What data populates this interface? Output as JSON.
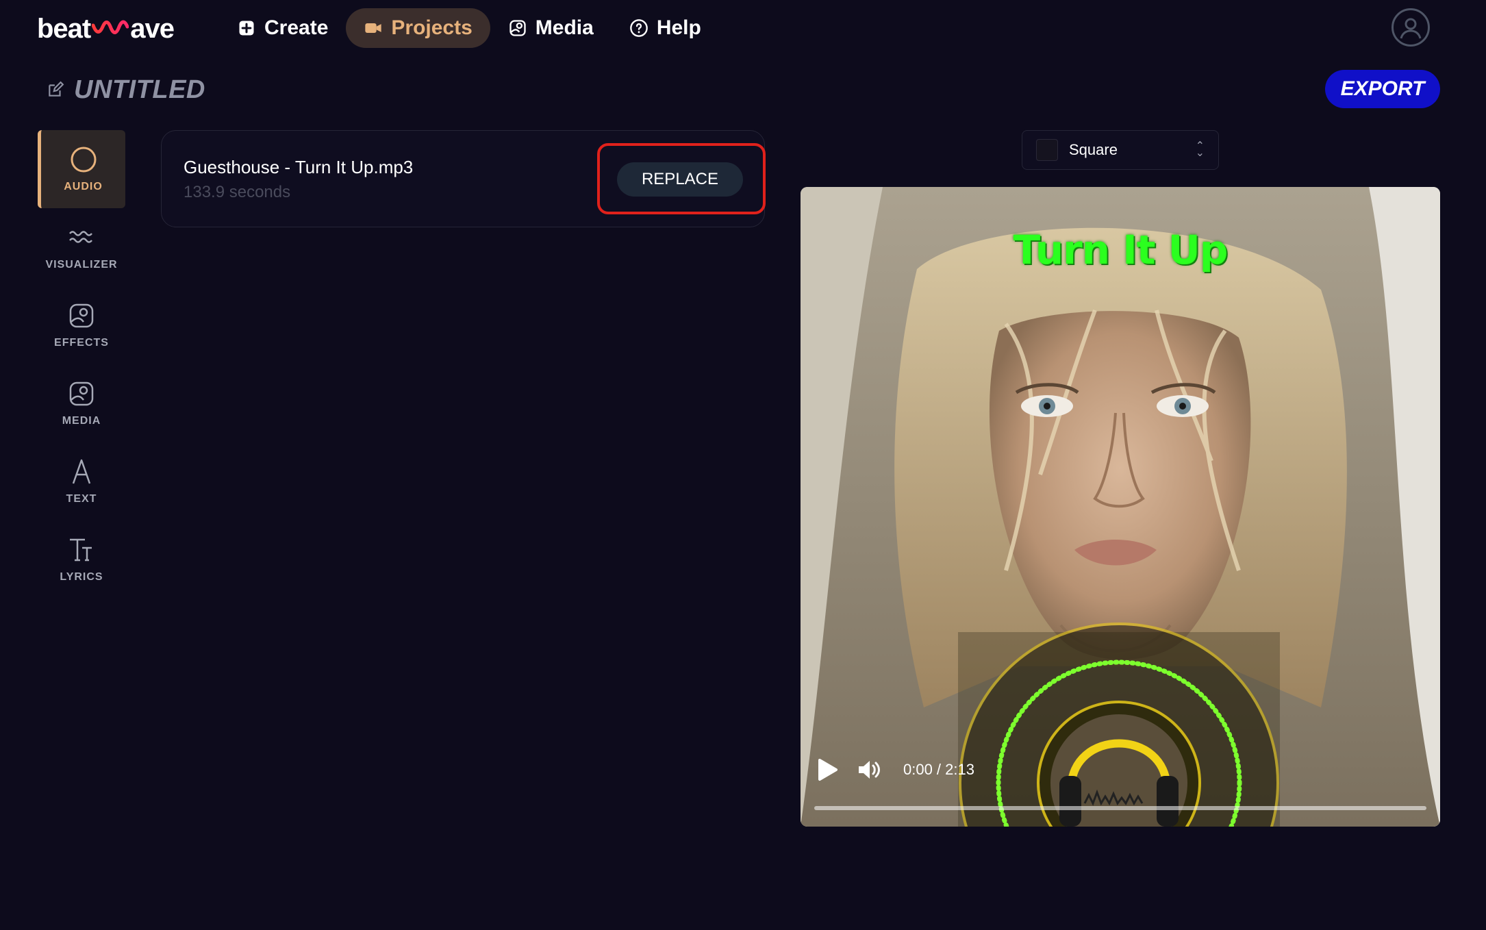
{
  "app": {
    "logo_left": "beat",
    "logo_right": "ave"
  },
  "nav": {
    "items": [
      {
        "label": "Create",
        "icon": "plus-square-icon"
      },
      {
        "label": "Projects",
        "icon": "video-camera-icon",
        "active": true
      },
      {
        "label": "Media",
        "icon": "image-icon"
      },
      {
        "label": "Help",
        "icon": "question-circle-icon"
      }
    ]
  },
  "project": {
    "title": "UNTITLED",
    "export_label": "EXPORT"
  },
  "sidebar": {
    "items": [
      {
        "label": "AUDIO",
        "icon": "circle-icon",
        "active": true
      },
      {
        "label": "VISUALIZER",
        "icon": "waves-icon"
      },
      {
        "label": "EFFECTS",
        "icon": "image-effects-icon"
      },
      {
        "label": "MEDIA",
        "icon": "image-icon"
      },
      {
        "label": "TEXT",
        "icon": "letter-a-icon"
      },
      {
        "label": "LYRICS",
        "icon": "typography-icon"
      }
    ]
  },
  "audio": {
    "file_name": "Guesthouse - Turn It Up.mp3",
    "duration": "133.9 seconds",
    "replace_label": "REPLACE"
  },
  "aspect": {
    "selected": "Square"
  },
  "preview": {
    "overlay_title": "Turn It Up",
    "time": "0:00 / 2:13",
    "progress": 0
  },
  "colors": {
    "background": "#0d0b1c",
    "accent": "#e7b27c",
    "export": "#1010c8",
    "highlight": "#e0211b",
    "overlay_text": "#2bff1f"
  }
}
